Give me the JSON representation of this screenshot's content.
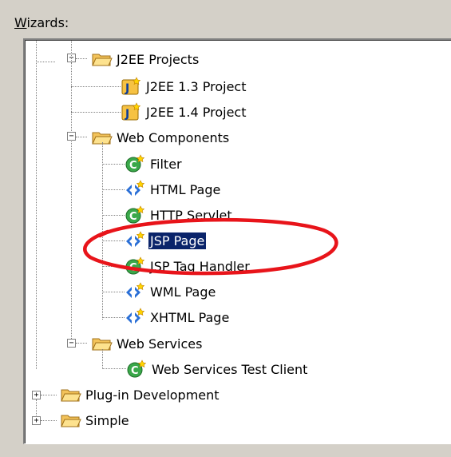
{
  "wizards_label": {
    "accel": "W",
    "rest": "izards:"
  },
  "tree": {
    "j2ee_projects": "J2EE Projects",
    "j2ee13": "J2EE 1.3 Project",
    "j2ee14": "J2EE 1.4 Project",
    "web_components": "Web Components",
    "filter": "Filter",
    "html_page": "HTML Page",
    "http_servlet": "HTTP Servlet",
    "jsp_page": "JSP Page",
    "jsp_tag_handler": "JSP Tag Handler",
    "wml_page": "WML Page",
    "xhtml_page": "XHTML Page",
    "web_services": "Web Services",
    "ws_test_client": "Web Services Test Client",
    "plugin_dev": "Plug-in Development",
    "simple": "Simple"
  },
  "expander": {
    "collapse": "−",
    "expand": "+"
  },
  "colors": {
    "selection": "#0a246a",
    "annotation": "#e8141a",
    "folder": "#f3c35a"
  }
}
